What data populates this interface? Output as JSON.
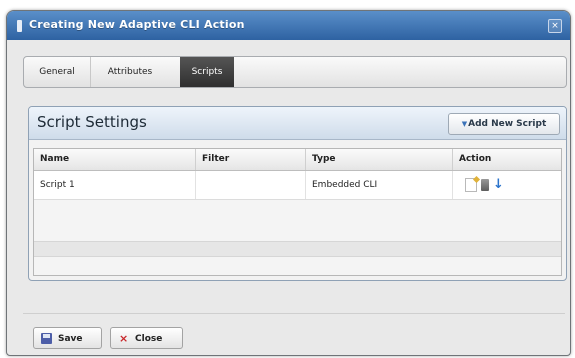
{
  "window": {
    "title": "Creating New Adaptive CLI Action",
    "close_glyph": "×"
  },
  "tabs": [
    {
      "label": "General",
      "active": false
    },
    {
      "label": "Attributes",
      "active": false
    },
    {
      "label": "Scripts",
      "active": true
    }
  ],
  "script_settings": {
    "title": "Script Settings",
    "add_button_label": "Add New Script",
    "add_button_arrow": "▼"
  },
  "table": {
    "columns": [
      "Name",
      "Filter",
      "Type",
      "Action"
    ],
    "rows": [
      {
        "name": "Script 1",
        "filter": "",
        "type": "Embedded CLI",
        "actions": [
          "edit-icon",
          "trash-icon",
          "arrow-down-icon"
        ]
      }
    ]
  },
  "footer": {
    "save_label": "Save",
    "close_label": "Close",
    "close_glyph": "×"
  },
  "colors": {
    "titlebar": "#2e62a2",
    "active_tab": "#2f2f2f",
    "close_icon": "#c8262a",
    "down_arrow": "#2b74cc"
  }
}
